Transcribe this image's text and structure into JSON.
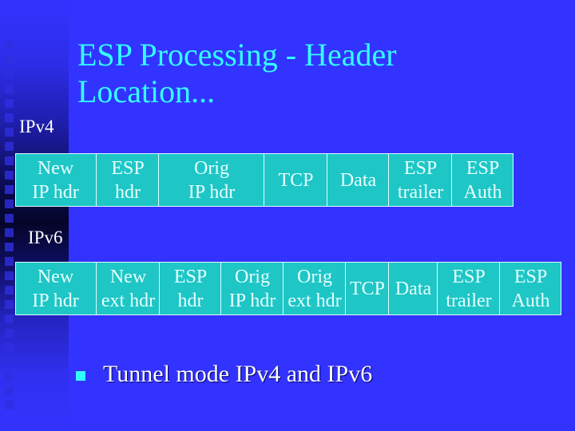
{
  "slide": {
    "title_line1": "ESP Processing - Header",
    "title_line2": "Location...",
    "colors": {
      "background": "#3333ff",
      "title": "#33ffff",
      "cell_fill": "#1ec6c6",
      "cell_text": "#e8ffff",
      "bullet": "#33ffff"
    }
  },
  "ipv4": {
    "label": "IPv4",
    "cells": [
      {
        "text": "New\nIP hdr"
      },
      {
        "text": "ESP\nhdr"
      },
      {
        "text": "Orig\nIP hdr"
      },
      {
        "text": "TCP"
      },
      {
        "text": "Data"
      },
      {
        "text": "ESP\ntrailer"
      },
      {
        "text": "ESP\nAuth"
      }
    ]
  },
  "ipv6": {
    "label": "IPv6",
    "cells": [
      {
        "text": "New\nIP hdr"
      },
      {
        "text": "New\next hdr"
      },
      {
        "text": "ESP\nhdr"
      },
      {
        "text": "Orig\nIP hdr"
      },
      {
        "text": "Orig\next hdr"
      },
      {
        "text": "TCP"
      },
      {
        "text": "Data"
      },
      {
        "text": "ESP\ntrailer"
      },
      {
        "text": "ESP\nAuth"
      }
    ]
  },
  "bullets": [
    {
      "icon": "square-bullet-icon",
      "text": "Tunnel mode IPv4 and IPv6"
    }
  ]
}
